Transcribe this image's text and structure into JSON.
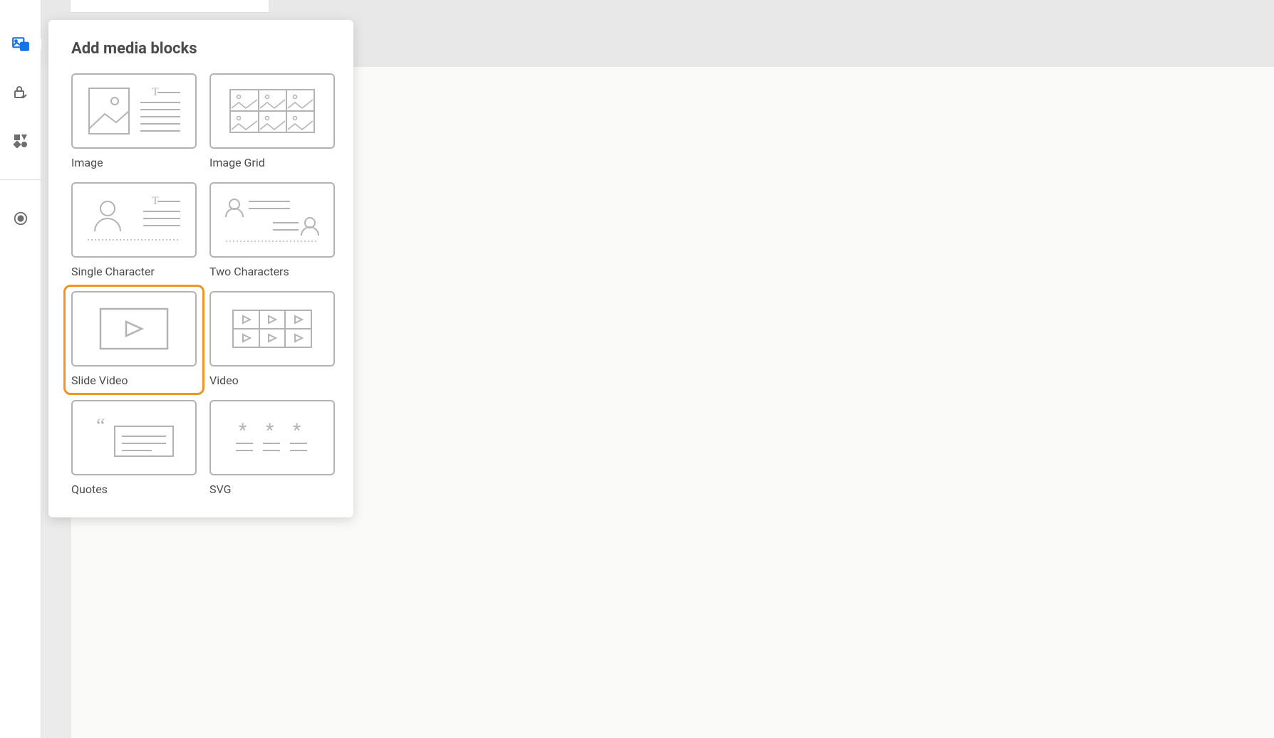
{
  "panel": {
    "title": "Add media blocks",
    "blocks": [
      {
        "label": "Image",
        "selected": false
      },
      {
        "label": "Image Grid",
        "selected": false
      },
      {
        "label": "Single Character",
        "selected": false
      },
      {
        "label": "Two Characters",
        "selected": false
      },
      {
        "label": "Slide Video",
        "selected": true
      },
      {
        "label": "Video",
        "selected": false
      },
      {
        "label": "Quotes",
        "selected": false
      },
      {
        "label": "SVG",
        "selected": false
      }
    ]
  },
  "rail": {
    "items": [
      {
        "name": "media-icon",
        "active": true
      },
      {
        "name": "lock-check-icon",
        "active": false
      },
      {
        "name": "shapes-icon",
        "active": false
      }
    ],
    "record": {
      "name": "record-icon",
      "active": false
    }
  }
}
